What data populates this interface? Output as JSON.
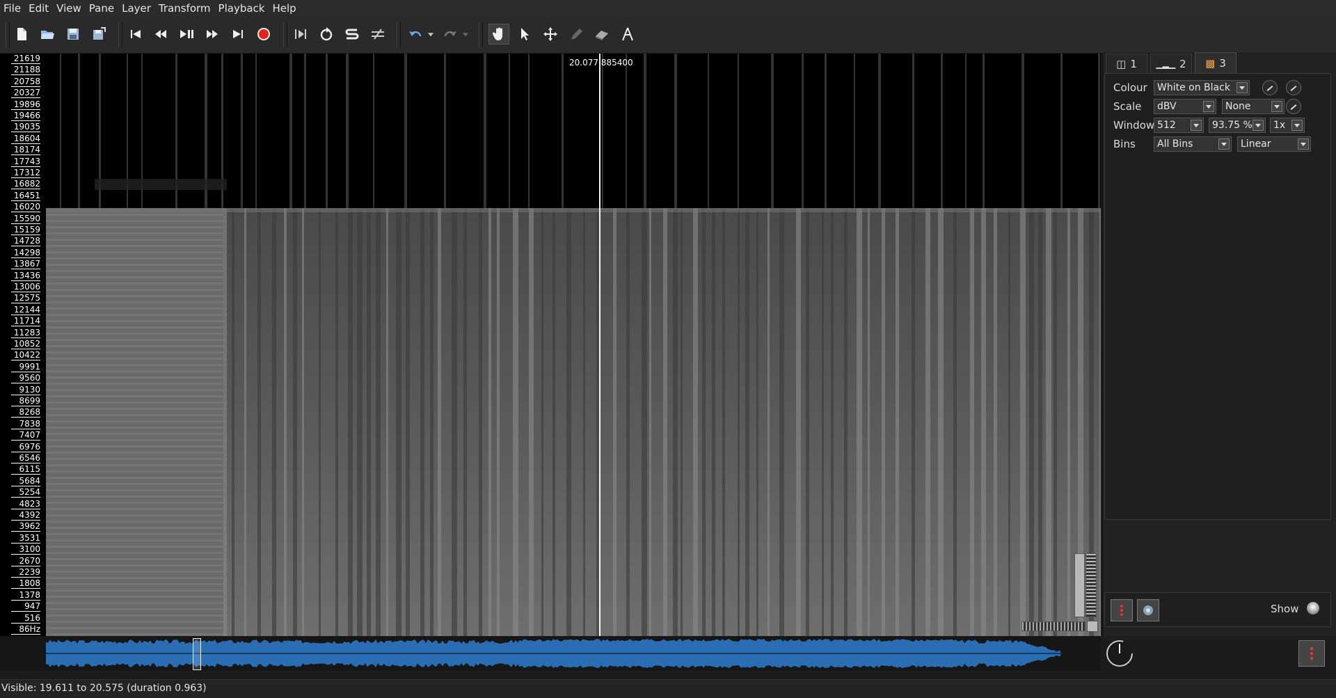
{
  "menubar": {
    "items": [
      "File",
      "Edit",
      "View",
      "Pane",
      "Layer",
      "Transform",
      "Playback",
      "Help"
    ]
  },
  "toolbar": {
    "buttons": [
      "new-document-icon",
      "open-folder-icon",
      "save-icon",
      "save-session-icon",
      "rewind-start-icon",
      "rewind-icon",
      "play-pause-icon",
      "fast-forward-icon",
      "fast-forward-end-icon",
      "record-icon",
      "constrain-playback-icon",
      "loop-icon",
      "solo-icon",
      "speedup-icon",
      "undo-icon",
      "undo-menu-icon",
      "redo-icon",
      "redo-menu-icon",
      "navigate-tool-icon",
      "select-tool-icon",
      "move-tool-icon",
      "draw-tool-icon",
      "erase-tool-icon",
      "measure-tool-icon"
    ],
    "record_color": "#e0241b"
  },
  "pane": {
    "cursor_readout": "20.077  885400",
    "scale_labels": [
      "21619",
      "21188",
      "20758",
      "20327",
      "19896",
      "19466",
      "19035",
      "18604",
      "18174",
      "17743",
      "17312",
      "16882",
      "16451",
      "16020",
      "15590",
      "15159",
      "14728",
      "14298",
      "13867",
      "13436",
      "13006",
      "12575",
      "12144",
      "11714",
      "11283",
      "10852",
      "10422",
      "9991",
      "9560",
      "9130",
      "8699",
      "8268",
      "7838",
      "7407",
      "6976",
      "6546",
      "6115",
      "5684",
      "5254",
      "4823",
      "4392",
      "3962",
      "3531",
      "3100",
      "2670",
      "2239",
      "1808",
      "1378",
      "947",
      "516",
      "86Hz"
    ]
  },
  "overview": {
    "waveform_color": "#2a6db3"
  },
  "panel": {
    "tabs": [
      {
        "label": "1",
        "icon": "pane-icon"
      },
      {
        "label": "2",
        "icon": "ruler-icon"
      },
      {
        "label": "3",
        "icon": "spectrogram-icon"
      }
    ],
    "active_tab": "3",
    "colour": {
      "label": "Colour",
      "value": "White on Black"
    },
    "scale": {
      "label": "Scale",
      "value": "dBV",
      "normalize": "None"
    },
    "window": {
      "label": "Window",
      "size": "512",
      "overlap": "93.75 %",
      "oversample": "1x"
    },
    "bins": {
      "label": "Bins",
      "value": "All Bins",
      "scale": "Linear"
    },
    "show_label": "Show"
  },
  "status": {
    "text": "Visible: 19.611 to 20.575 (duration 0.963)"
  }
}
